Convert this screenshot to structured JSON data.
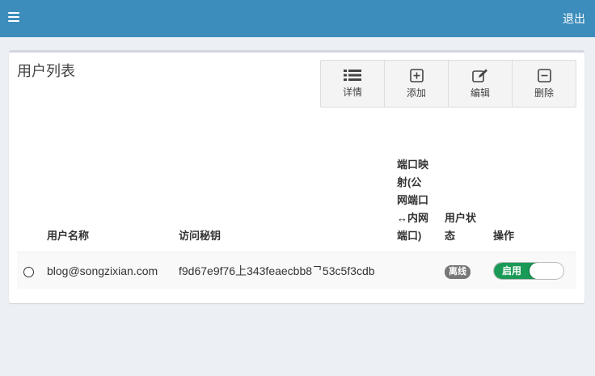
{
  "header": {
    "logout_label": "退出"
  },
  "panel": {
    "title": "用户列表"
  },
  "toolbar": {
    "detail_label": "详情",
    "add_label": "添加",
    "edit_label": "编辑",
    "delete_label": "删除"
  },
  "table": {
    "headers": {
      "username": "用户名称",
      "secret": "访问秘钥",
      "port_mapping": "端口映射(公网端口↔内网端口)",
      "status": "用户状态",
      "action": "操作"
    },
    "rows": [
      {
        "username": "blog@songzixian.com",
        "secret": "f9d67e9f76上343feaecbb8ᄀ53c5f3cdb",
        "port_mapping": "",
        "status": "离线",
        "toggle_label": "启用"
      }
    ]
  },
  "colors": {
    "header_bg": "#3c8dbc",
    "toggle_on": "#1a9a56",
    "badge_offline": "#777777"
  }
}
